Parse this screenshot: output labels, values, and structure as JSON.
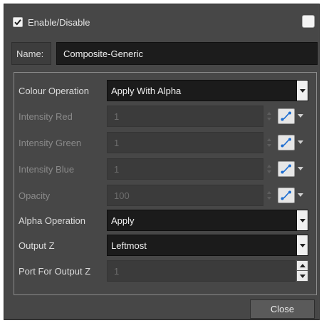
{
  "header": {
    "enable_label": "Enable/Disable",
    "enabled": true
  },
  "name": {
    "label": "Name:",
    "value": "Composite-Generic"
  },
  "properties": {
    "colour_operation": {
      "label": "Colour Operation",
      "value": "Apply With Alpha"
    },
    "intensity_red": {
      "label": "Intensity Red",
      "value": "1"
    },
    "intensity_green": {
      "label": "Intensity Green",
      "value": "1"
    },
    "intensity_blue": {
      "label": "Intensity Blue",
      "value": "1"
    },
    "opacity": {
      "label": "Opacity",
      "value": "100"
    },
    "alpha_operation": {
      "label": "Alpha Operation",
      "value": "Apply"
    },
    "output_z": {
      "label": "Output Z",
      "value": "Leftmost"
    },
    "port_for_output_z": {
      "label": "Port For Output Z",
      "value": "1"
    }
  },
  "footer": {
    "close_label": "Close"
  },
  "icons": {
    "checkbox": "checkmark-icon",
    "function": "function-curve-icon",
    "dropdown": "chevron-down-icon"
  },
  "colors": {
    "dialog_bg": "#474747",
    "field_bg": "#1b1b1b",
    "disabled_field_bg": "#3b3b3b",
    "text": "#dcdcdc",
    "disabled_text": "#8a8a8a",
    "fn_curve_accent": "#1f6fd1"
  }
}
